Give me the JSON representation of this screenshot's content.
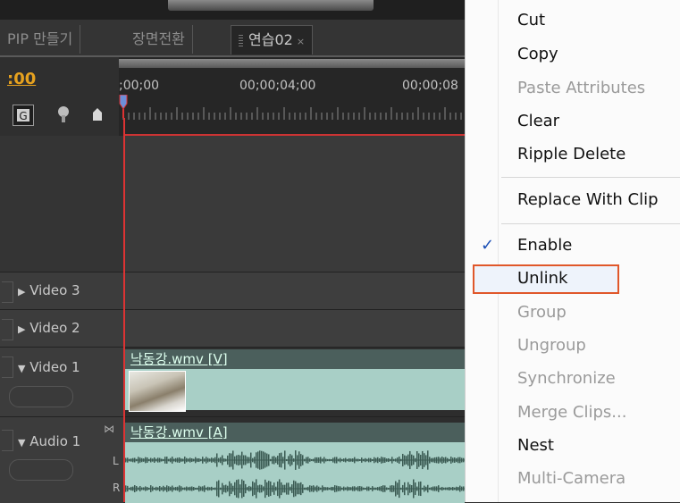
{
  "tabs": [
    {
      "label": "PIP 만들기"
    },
    {
      "label": "장면전환"
    },
    {
      "label": "연습02",
      "close": "×"
    }
  ],
  "timecode": ":00",
  "ruler": {
    "labels": [
      ";00;00",
      "00;00;04;00",
      "00;00;08"
    ]
  },
  "tracks": {
    "video3": {
      "label": "Video 3",
      "arrow": "▶"
    },
    "video2": {
      "label": "Video 2",
      "arrow": "▶"
    },
    "video1": {
      "label": "Video 1",
      "arrow": "▼",
      "clip": "낙동강.wmv [V]"
    },
    "audio1": {
      "label": "Audio 1",
      "arrow": "▼",
      "clip": "낙동강.wmv [A]",
      "left": "L",
      "right": "R"
    }
  },
  "context_menu": {
    "items": [
      {
        "label": "Cut",
        "enabled": true
      },
      {
        "label": "Copy",
        "enabled": true
      },
      {
        "label": "Paste Attributes",
        "enabled": false
      },
      {
        "label": "Clear",
        "enabled": true
      },
      {
        "label": "Ripple Delete",
        "enabled": true
      },
      {
        "label": "Replace With Clip",
        "enabled": true
      },
      {
        "label": "Enable",
        "enabled": true,
        "checked": true
      },
      {
        "label": "Unlink",
        "enabled": true,
        "highlighted": true
      },
      {
        "label": "Group",
        "enabled": false
      },
      {
        "label": "Ungroup",
        "enabled": false
      },
      {
        "label": "Synchronize",
        "enabled": false
      },
      {
        "label": "Merge Clips...",
        "enabled": false
      },
      {
        "label": "Nest",
        "enabled": true
      },
      {
        "label": "Multi-Camera",
        "enabled": false
      }
    ],
    "check_glyph": "✓",
    "highlight_color": "#e0572a"
  },
  "colors": {
    "timecode": "#e7a21f",
    "playhead": "#dd3333",
    "clip_bg": "#a8cfc6"
  }
}
